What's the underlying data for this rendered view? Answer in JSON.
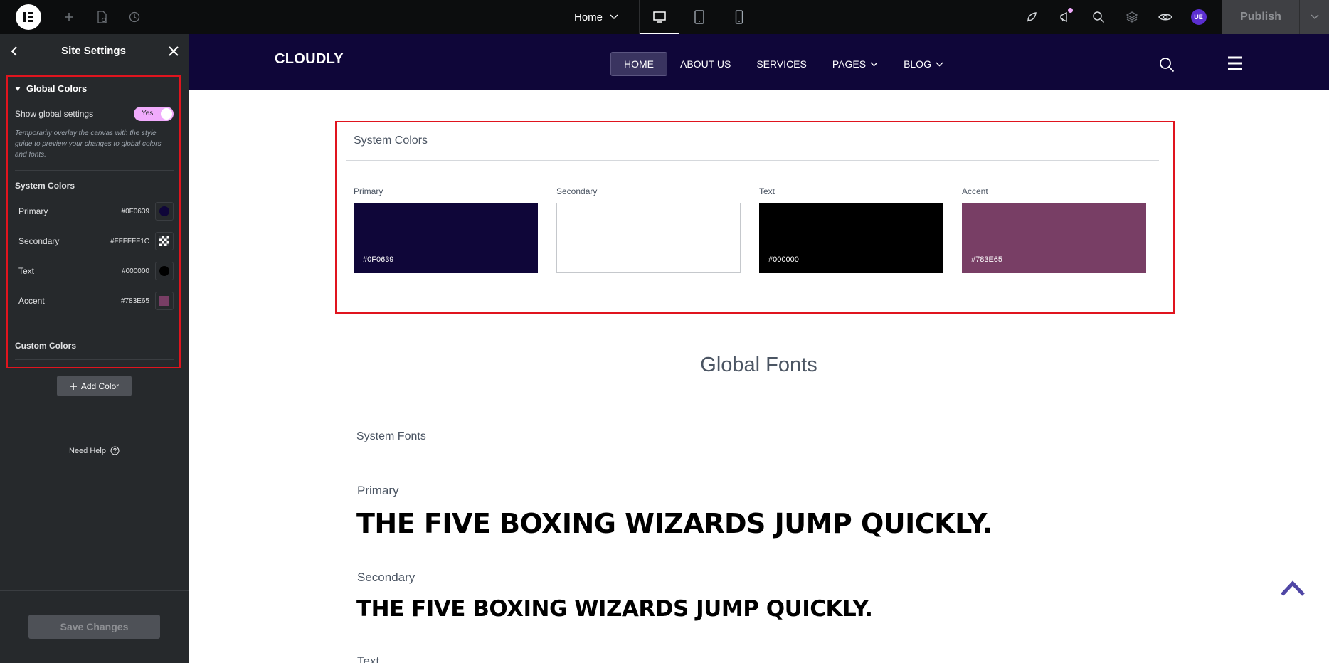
{
  "topbar": {
    "page_name": "Home",
    "publish_label": "Publish",
    "avatar_initials": "UE"
  },
  "sidebar": {
    "title": "Site Settings",
    "section_title": "Global Colors",
    "show_global_label": "Show global settings",
    "toggle_label": "Yes",
    "hint": "Temporarily overlay the canvas with the style guide to preview your changes to global colors and fonts.",
    "system_colors_title": "System Colors",
    "colors": [
      {
        "name": "Primary",
        "hex": "#0F0639",
        "swatch": "#0f0639"
      },
      {
        "name": "Secondary",
        "hex": "#FFFFFF1C",
        "swatch": "checker"
      },
      {
        "name": "Text",
        "hex": "#000000",
        "swatch": "#000000"
      },
      {
        "name": "Accent",
        "hex": "#783E65",
        "swatch": "#783e65"
      }
    ],
    "custom_colors_title": "Custom Colors",
    "add_color_label": "Add Color",
    "need_help_label": "Need Help",
    "save_label": "Save Changes"
  },
  "site": {
    "logo": "CLOUDLY",
    "nav": [
      {
        "label": "HOME",
        "active": true,
        "dropdown": false
      },
      {
        "label": "ABOUT US",
        "active": false,
        "dropdown": false
      },
      {
        "label": "SERVICES",
        "active": false,
        "dropdown": false
      },
      {
        "label": "PAGES",
        "active": false,
        "dropdown": true
      },
      {
        "label": "BLOG",
        "active": false,
        "dropdown": true
      }
    ],
    "brand_color": "#0f0639"
  },
  "canvas": {
    "system_colors_title": "System Colors",
    "swatches": [
      {
        "label": "Primary",
        "hex": "#0F0639",
        "color": "#0f0639",
        "text_color": "#ffffff"
      },
      {
        "label": "Secondary",
        "hex": "",
        "color": "#ffffff",
        "text_color": "#000000"
      },
      {
        "label": "Text",
        "hex": "#000000",
        "color": "#000000",
        "text_color": "#ffffff"
      },
      {
        "label": "Accent",
        "hex": "#783E65",
        "color": "#783e65",
        "text_color": "#ffffff"
      }
    ],
    "global_fonts_title": "Global Fonts",
    "system_fonts_title": "System Fonts",
    "fonts": [
      {
        "label": "Primary",
        "sample": "THE FIVE BOXING WIZARDS JUMP QUICKLY."
      },
      {
        "label": "Secondary",
        "sample": "THE FIVE BOXING WIZARDS JUMP QUICKLY."
      },
      {
        "label": "Text",
        "sample": ""
      }
    ]
  }
}
